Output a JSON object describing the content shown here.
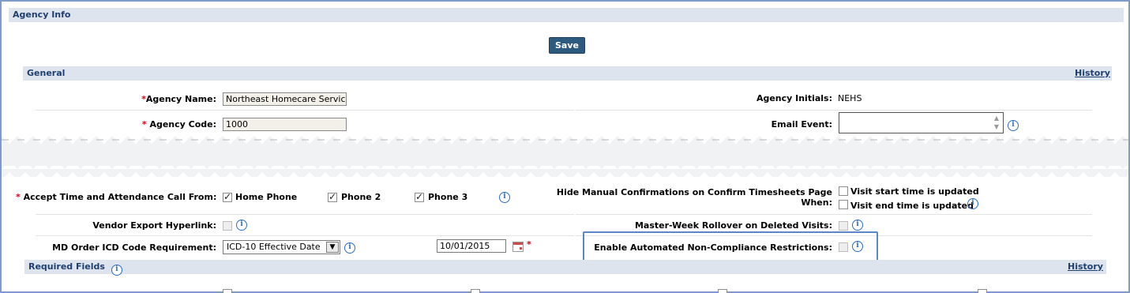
{
  "page_title": "Agency Info",
  "save_label": "Save",
  "general": {
    "title": "General",
    "history_label": "History",
    "agency_name": {
      "req": "*",
      "label": "Agency Name:",
      "value": "Northeast Homecare Service"
    },
    "agency_code": {
      "req": "*",
      "label": "Agency Code:",
      "value": "1000"
    },
    "agency_initials": {
      "label": "Agency Initials:",
      "value": "NEHS"
    },
    "email_event": {
      "label": "Email Event:",
      "value": ""
    }
  },
  "call_from": {
    "req": "*",
    "label": "Accept Time and Attendance Call From:",
    "options": [
      {
        "label": "Home Phone",
        "checked": true
      },
      {
        "label": "Phone 2",
        "checked": true
      },
      {
        "label": "Phone 3",
        "checked": true
      }
    ]
  },
  "hide_manual": {
    "label_line1": "Hide Manual Confirmations on Confirm Timesheets Page",
    "label_line2": "When:",
    "options": [
      {
        "label": "Visit start time is updated",
        "checked": false
      },
      {
        "label": "Visit end time is updated",
        "checked": false
      }
    ]
  },
  "vendor_export": {
    "label": "Vendor Export Hyperlink:",
    "checked": false
  },
  "master_week": {
    "label": "Master-Week Rollover on Deleted Visits:",
    "checked": false
  },
  "md_order": {
    "label": "MD Order ICD Code Requirement:",
    "selected": "ICD-10 Effective Date",
    "date": "10/01/2015",
    "req": "*"
  },
  "automated_noncompliance": {
    "label": "Enable Automated Non-Compliance Restrictions:",
    "checked": false
  },
  "required_fields": {
    "title": "Required Fields",
    "history_label": "History"
  },
  "info_glyph": "i",
  "colors": {
    "section_bar": "#dde4ee",
    "header_text": "#1f3f6e",
    "save_button": "#2f5a80",
    "required": "#d0021b",
    "highlight": "#5b86c9",
    "info": "#2d6dbf"
  }
}
